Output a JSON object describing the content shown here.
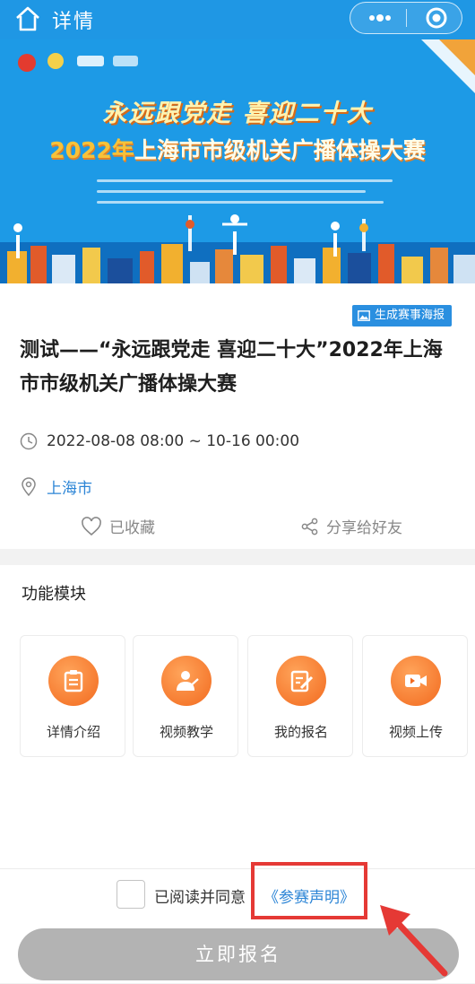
{
  "nav": {
    "title": "详情"
  },
  "banner": {
    "slogan": "永远跟党走 喜迎二十大",
    "year_text": "2022年",
    "title_rest": "上海市市级机关广播体操大赛"
  },
  "event": {
    "poster_button": "生成赛事海报",
    "title": "测试——“永远跟党走 喜迎二十大”2022年上海市市级机关广播体操大赛",
    "time": "2022-08-08 08:00 ~ 10-16 00:00",
    "location": "上海市",
    "favorite_label": "已收藏",
    "share_label": "分享给好友"
  },
  "modules": {
    "title": "功能模块",
    "items": [
      {
        "label": "详情介绍",
        "icon": "clipboard-icon"
      },
      {
        "label": "视频教学",
        "icon": "teacher-icon"
      },
      {
        "label": "我的报名",
        "icon": "edit-form-icon"
      },
      {
        "label": "视频上传",
        "icon": "video-camera-icon"
      }
    ]
  },
  "footer": {
    "agree_text": "已阅读并同意",
    "statement_link": "《参赛声明》",
    "signup_button": "立即报名"
  },
  "colors": {
    "header_blue": "#1f97e4",
    "link_blue": "#2c85d6",
    "module_orange": "#f26a1f",
    "annotation_red": "#e53935",
    "disabled_button": "#b3b3b3"
  }
}
